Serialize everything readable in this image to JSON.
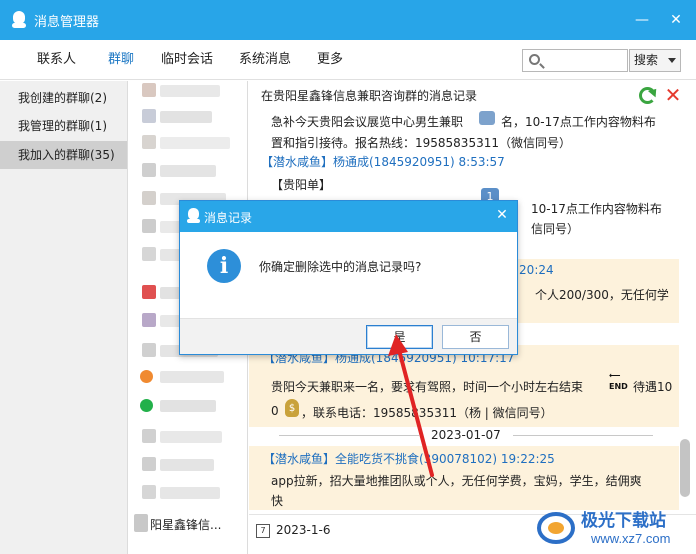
{
  "window": {
    "title": "消息管理器",
    "minimize": "—",
    "close": "✕"
  },
  "menu": {
    "tabs": [
      "联系人",
      "群聊",
      "临时会话",
      "系统消息",
      "更多"
    ],
    "active": "群聊"
  },
  "search": {
    "value": "",
    "button_label": "搜索"
  },
  "categories": [
    {
      "label": "我创建的群聊(2)"
    },
    {
      "label": "我管理的群聊(1)"
    },
    {
      "label": "我加入的群聊(35)"
    }
  ],
  "group_list": {
    "visible_label": "阳星鑫锋信..."
  },
  "messages": {
    "header": "在贵阳星鑫锋信息兼职咨询群的消息记录",
    "line1a": "急补今天贵阳会议展览中心男生兼职",
    "line1b": "名，10-17点工作内容物料布",
    "line2": "置和指引接待。报名热线：19585835311（微信同号）",
    "sender1": "【潜水咸鱼】杨通成(1845920951) 8:53:57",
    "line3": "【贵阳单】",
    "line4": "10-17点工作内容物料布",
    "line5": "信同号）",
    "time_frag": ":20:24",
    "line6": "个人200/300，无任何学",
    "sender2": "【潜水咸鱼】杨通成(1845920951) 10:17:17",
    "line7a": "贵阳今天兼职来一名，要求有驾照，时间一个小时左右结束",
    "line7b": "待遇10",
    "line8a": "0",
    "line8b": "，联系电话：19585835311（杨 | 微信同号）",
    "date_sep": "2023-01-07",
    "sender3": "【潜水咸鱼】全能吃货不挑食(390078102) 19:22:25",
    "line9": "app拉新，招大量地推团队或个人，无任何学费，宝妈，学生，结佣爽",
    "line10": "快",
    "badge1": "1",
    "badge2": "1",
    "end_label": "END",
    "bottom_date": "2023-1-6",
    "cal_icon_digit": "7"
  },
  "dialog": {
    "title": "消息记录",
    "close": "✕",
    "info_glyph": "i",
    "message": "你确定删除选中的消息记录吗?",
    "ok_label": "是",
    "cancel_label": "否"
  },
  "watermark": {
    "text": "极光下载站",
    "url": "www.xz7.com"
  },
  "colors": {
    "titlebar": "#28a5e8",
    "accent": "#1b77c4",
    "sender": "#1f6fbf",
    "bubble": "#fdf2dc",
    "arrow": "#e02424"
  }
}
